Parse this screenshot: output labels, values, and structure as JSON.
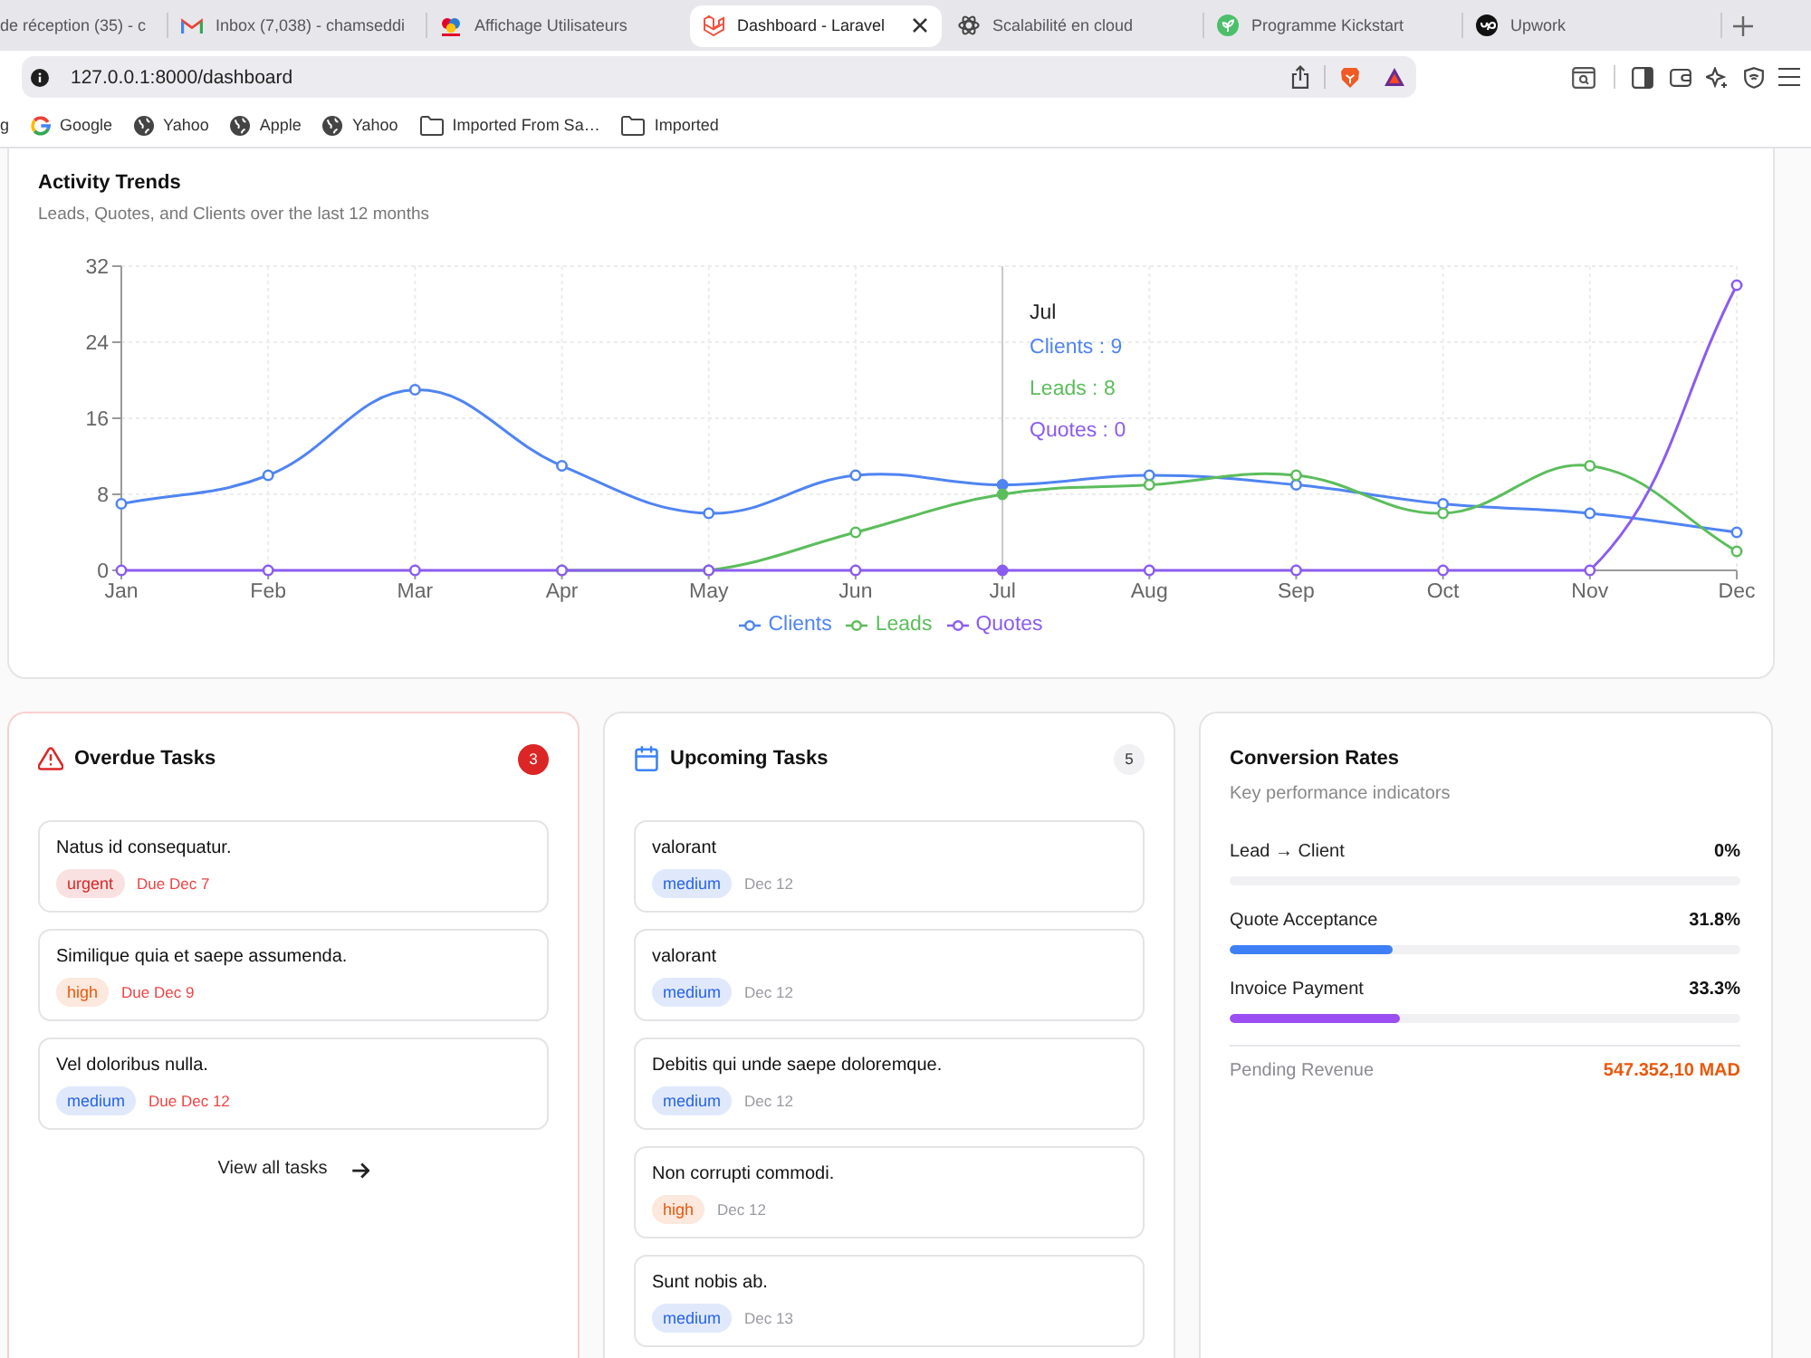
{
  "browser": {
    "tabs": [
      {
        "title": "de réception (35) - c",
        "selected": false
      },
      {
        "title": "Inbox (7,038) - chamseddi",
        "selected": false
      },
      {
        "title": "Affichage Utilisateurs",
        "selected": false
      },
      {
        "title": "Dashboard - Laravel",
        "selected": true
      },
      {
        "title": "Scalabilité en cloud",
        "selected": false
      },
      {
        "title": "Programme Kickstart",
        "selected": false
      },
      {
        "title": "Upwork",
        "selected": false
      }
    ],
    "url": "127.0.0.1:8000/dashboard",
    "bookmarks": [
      {
        "label": "g",
        "kind": "label"
      },
      {
        "label": "Google",
        "kind": "favicon"
      },
      {
        "label": "Yahoo",
        "kind": "site"
      },
      {
        "label": "Apple",
        "kind": "site"
      },
      {
        "label": "Yahoo",
        "kind": "site"
      },
      {
        "label": "Imported From Sa…",
        "kind": "folder"
      },
      {
        "label": "Imported",
        "kind": "folder"
      }
    ]
  },
  "activity": {
    "title": "Activity Trends",
    "subtitle": "Leads, Quotes, and Clients over the last 12 months",
    "chart_data": {
      "type": "line",
      "categories": [
        "Jan",
        "Feb",
        "Mar",
        "Apr",
        "May",
        "Jun",
        "Jul",
        "Aug",
        "Sep",
        "Oct",
        "Nov",
        "Dec"
      ],
      "series": [
        {
          "name": "Clients",
          "color": "#4f84f2",
          "marker": "circle",
          "values": [
            7,
            10,
            19,
            11,
            6,
            10,
            9,
            10,
            9,
            7,
            6,
            4
          ]
        },
        {
          "name": "Leads",
          "color": "#5cbd5c",
          "marker": "circle",
          "values": [
            null,
            null,
            null,
            0,
            0,
            4,
            8,
            9,
            10,
            6,
            11,
            2
          ]
        },
        {
          "name": "Quotes",
          "color": "#8b5cf0",
          "marker": "circle",
          "values": [
            0,
            0,
            0,
            0,
            0,
            0,
            0,
            0,
            0,
            0,
            0,
            30
          ]
        }
      ],
      "ylim": [
        0,
        32
      ],
      "yticks": [
        0,
        8,
        16,
        24,
        32
      ],
      "grid": true,
      "legend": "bottom",
      "ref_lines": [
        {
          "axis": "x",
          "value": "Jul",
          "color": "#c8c8c8"
        }
      ]
    },
    "tooltip": {
      "title": "Jul",
      "lines": [
        "Clients : 9",
        "Leads : 8",
        "Quotes : 0"
      ]
    }
  },
  "task_panels": [
    {
      "kind": "overdue",
      "title": "Overdue Tasks",
      "count": "3",
      "tasks": [
        {
          "title": "Natus id consequatur.",
          "priority": "urgent",
          "color": "#dc2626",
          "due": "Due Dec 7"
        },
        {
          "title": "Similique quia et saepe assumenda.",
          "priority": "high",
          "color": "#ea580c",
          "due": "Due Dec 9"
        },
        {
          "title": "Vel doloribus nulla.",
          "priority": "medium",
          "color": "#2563eb",
          "due": "Due Dec 12"
        }
      ],
      "link": "View all tasks"
    },
    {
      "kind": "upcoming",
      "title": "Upcoming Tasks",
      "count": "5",
      "tasks": [
        {
          "title": "valorant",
          "priority": "medium",
          "color": "#2563eb",
          "due": "Dec 12"
        },
        {
          "title": "valorant",
          "priority": "medium",
          "color": "#2563eb",
          "due": "Dec 12"
        },
        {
          "title": "Debitis qui unde saepe doloremque.",
          "priority": "medium",
          "color": "#2563eb",
          "due": "Dec 12"
        },
        {
          "title": "Non corrupti commodi.",
          "priority": "high",
          "color": "#ea580c",
          "due": "Dec 12"
        },
        {
          "title": "Sunt nobis ab.",
          "priority": "medium",
          "color": "#2563eb",
          "due": "Dec 13"
        }
      ]
    }
  ],
  "conversion": {
    "title": "Conversion Rates",
    "subtitle": "Key performance indicators",
    "rates": [
      {
        "label": "Lead → Client",
        "value": "0%",
        "level": 0
      },
      {
        "label": "Quote Acceptance",
        "value": "31.8%",
        "level": 0.318,
        "color": "#3f7ff5"
      },
      {
        "label": "Invoice Payment",
        "value": "33.3%",
        "level": 0.333,
        "color": "#9b4ff2"
      }
    ],
    "pending": {
      "label": "Pending Revenue",
      "value": "547.352,10 MAD"
    }
  }
}
